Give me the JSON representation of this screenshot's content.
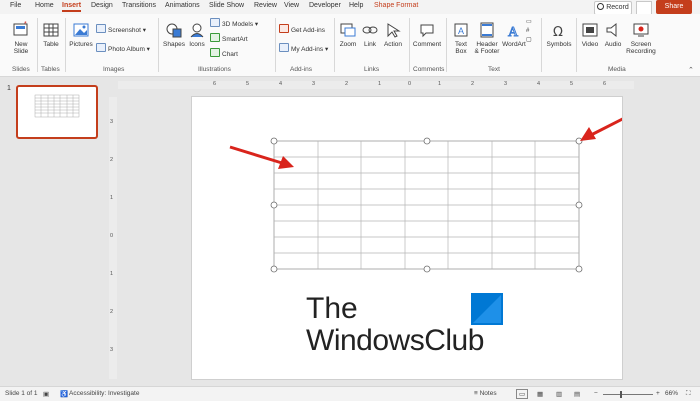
{
  "tabs": [
    "File",
    "Home",
    "Insert",
    "Design",
    "Transitions",
    "Animations",
    "Slide Show",
    "Review",
    "View",
    "Developer",
    "Help",
    "Shape Format"
  ],
  "active_tab": "Insert",
  "record_label": "Record",
  "share_label": "Share",
  "ribbon": {
    "new_slide": "New Slide",
    "table": "Table",
    "pictures": "Pictures",
    "screenshot": "Screenshot",
    "photo_album": "Photo Album",
    "shapes": "Shapes",
    "icons": "Icons",
    "models_3d": "3D Models",
    "smartart": "SmartArt",
    "chart": "Chart",
    "get_addins": "Get Add-ins",
    "my_addins": "My Add-ins",
    "zoom": "Zoom",
    "link": "Link",
    "action": "Action",
    "comment": "Comment",
    "text_box": "Text Box",
    "header_footer": "Header & Footer",
    "wordart": "WordArt",
    "symbols": "Symbols",
    "video": "Video",
    "audio": "Audio",
    "screen_recording": "Screen Recording"
  },
  "groups": [
    "Slides",
    "Tables",
    "Images",
    "Illustrations",
    "Add-ins",
    "Links",
    "Comments",
    "Text",
    "Media"
  ],
  "slide_number": "1",
  "ruler_h": [
    "6",
    "5",
    "4",
    "3",
    "2",
    "1",
    "0",
    "1",
    "2",
    "3",
    "4",
    "5",
    "6"
  ],
  "ruler_v": [
    "3",
    "2",
    "1",
    "0",
    "1",
    "2",
    "3"
  ],
  "logo": {
    "line1": "The",
    "line2": "WindowsClub"
  },
  "table": {
    "rows": 8,
    "cols": 7
  },
  "status": {
    "slide_info": "Slide 1 of 1",
    "accessibility": "Accessibility: Investigate",
    "notes": "Notes",
    "zoom": "66%"
  },
  "colors": {
    "accent": "#c43e1c",
    "arrow": "#d9241c",
    "logo_blue": "#0078d4"
  }
}
